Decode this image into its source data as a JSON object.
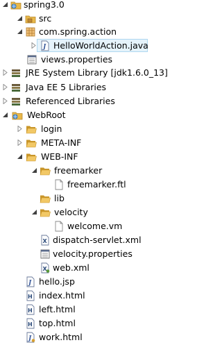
{
  "tree": {
    "project": {
      "label": "spring3.0",
      "icon": "web-project-icon"
    },
    "src": {
      "label": "src",
      "icon": "source-folder-icon"
    },
    "package": {
      "label": "com.spring.action",
      "icon": "package-icon"
    },
    "hello_action": {
      "label": "HelloWorldAction.java",
      "icon": "java-file-icon",
      "selected": true
    },
    "views_props": {
      "label": "views.properties",
      "icon": "properties-file-icon"
    },
    "jre": {
      "label": "JRE System Library [jdk1.6.0_13]",
      "icon": "library-icon"
    },
    "javaee": {
      "label": "Java EE 5 Libraries",
      "icon": "library-icon"
    },
    "referenced": {
      "label": "Referenced Libraries",
      "icon": "library-icon"
    },
    "webroot": {
      "label": "WebRoot",
      "icon": "web-folder-icon"
    },
    "login": {
      "label": "login",
      "icon": "folder-icon"
    },
    "metainf": {
      "label": "META-INF",
      "icon": "folder-icon"
    },
    "webinf": {
      "label": "WEB-INF",
      "icon": "folder-icon"
    },
    "freemarker": {
      "label": "freemarker",
      "icon": "folder-icon"
    },
    "freemarker_ftl": {
      "label": "freemarker.ftl",
      "icon": "file-icon"
    },
    "lib": {
      "label": "lib",
      "icon": "folder-icon"
    },
    "velocity": {
      "label": "velocity",
      "icon": "folder-icon"
    },
    "welcome_vm": {
      "label": "welcome.vm",
      "icon": "file-icon"
    },
    "dispatch": {
      "label": "dispatch-servlet.xml",
      "icon": "xml-file-icon"
    },
    "velocity_props": {
      "label": "velocity.properties",
      "icon": "properties-file-icon"
    },
    "webxml": {
      "label": "web.xml",
      "icon": "xml-file-icon"
    },
    "hello_jsp": {
      "label": "hello.jsp",
      "icon": "jsp-file-icon"
    },
    "index_html": {
      "label": "index.html",
      "icon": "html-file-icon"
    },
    "left_html": {
      "label": "left.html",
      "icon": "html-file-icon"
    },
    "top_html": {
      "label": "top.html",
      "icon": "html-file-icon"
    },
    "work_html": {
      "label": "work.html",
      "icon": "jsp-file-icon"
    }
  },
  "colors": {
    "folder": "#e8b84a",
    "folder_dark": "#c9962a",
    "selection_bg": "#e5f3fb",
    "selection_border": "#aed7f0",
    "twistie_expanded": "#404040",
    "twistie_collapsed": "#909090"
  }
}
